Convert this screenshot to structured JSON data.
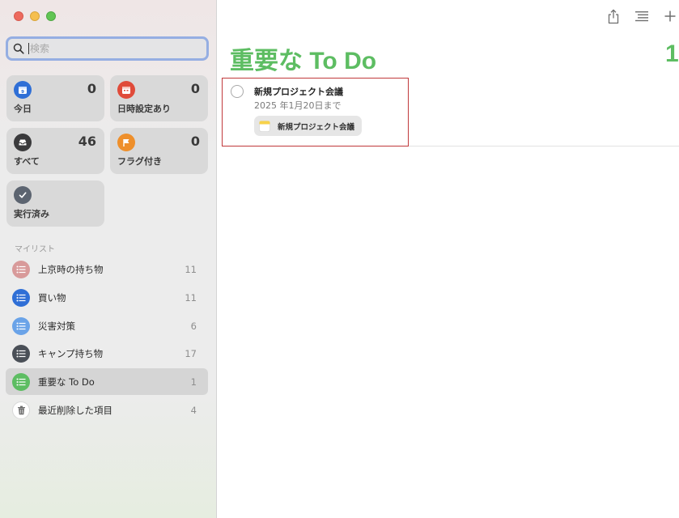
{
  "search": {
    "placeholder": "検索"
  },
  "smart_lists": {
    "today": {
      "label": "今日",
      "count": "0",
      "color": "#2f6fd6"
    },
    "scheduled": {
      "label": "日時設定あり",
      "count": "0",
      "color": "#e04b3a"
    },
    "all": {
      "label": "すべて",
      "count": "46",
      "color": "#3a3a3c"
    },
    "flagged": {
      "label": "フラグ付き",
      "count": "0",
      "color": "#ee8f2b"
    },
    "completed": {
      "label": "実行済み",
      "color": "#5c6470"
    }
  },
  "my_lists": {
    "section_title": "マイリスト",
    "items": [
      {
        "label": "上京時の持ち物",
        "count": "11",
        "color": "#d89a9a",
        "icon": "list-icon"
      },
      {
        "label": "買い物",
        "count": "11",
        "color": "#2f6fd6",
        "icon": "list-icon"
      },
      {
        "label": "災害対策",
        "count": "6",
        "color": "#6aa3e8",
        "icon": "list-icon"
      },
      {
        "label": "キャンプ持ち物",
        "count": "17",
        "color": "#4a4f57",
        "icon": "list-icon"
      },
      {
        "label": "重要な To Do",
        "count": "1",
        "color": "#5dbd62",
        "icon": "list-icon"
      },
      {
        "label": "最近削除した項目",
        "count": "4",
        "color": "#ffffff",
        "icon": "trash-icon"
      }
    ]
  },
  "main": {
    "title": "重要な To Do",
    "count": "1",
    "accent": "#5dbd62",
    "reminders": [
      {
        "title": "新規プロジェクト会議",
        "due": "2025 年1月20日まで",
        "attachment": "新規プロジェクト会議"
      }
    ]
  },
  "toolbar": {
    "share_icon": "share-icon",
    "view_icon": "view-options-icon",
    "add_icon": "plus-icon"
  }
}
